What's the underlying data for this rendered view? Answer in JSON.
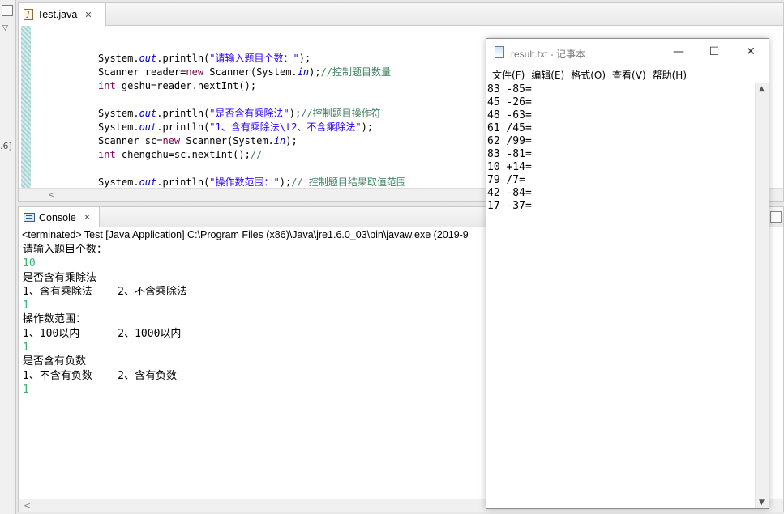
{
  "left_strip": {
    "annotation": ".6]"
  },
  "editor": {
    "tab_label": "Test.java",
    "code_lines": [
      [
        {
          "c": "pl",
          "t": "System."
        },
        {
          "c": "fld",
          "t": "out"
        },
        {
          "c": "pl",
          "t": ".println("
        },
        {
          "c": "str",
          "t": "\"请输入题目个数：\""
        },
        {
          "c": "pl",
          "t": ");"
        }
      ],
      [
        {
          "c": "pl",
          "t": "Scanner reader="
        },
        {
          "c": "kw",
          "t": "new"
        },
        {
          "c": "pl",
          "t": " Scanner(System."
        },
        {
          "c": "fld",
          "t": "in"
        },
        {
          "c": "pl",
          "t": ");"
        },
        {
          "c": "cmt",
          "t": "//控制题目数量"
        }
      ],
      [
        {
          "c": "kw",
          "t": "int"
        },
        {
          "c": "pl",
          "t": " geshu=reader.nextInt();"
        }
      ],
      [],
      [
        {
          "c": "pl",
          "t": "System."
        },
        {
          "c": "fld",
          "t": "out"
        },
        {
          "c": "pl",
          "t": ".println("
        },
        {
          "c": "str",
          "t": "\"是否含有乘除法\""
        },
        {
          "c": "pl",
          "t": ");"
        },
        {
          "c": "cmt",
          "t": "//控制题目操作符"
        }
      ],
      [
        {
          "c": "pl",
          "t": "System."
        },
        {
          "c": "fld",
          "t": "out"
        },
        {
          "c": "pl",
          "t": ".println("
        },
        {
          "c": "str",
          "t": "\"1、含有乘除法\\t2、不含乘除法\""
        },
        {
          "c": "pl",
          "t": ");"
        }
      ],
      [
        {
          "c": "pl",
          "t": "Scanner sc="
        },
        {
          "c": "kw",
          "t": "new"
        },
        {
          "c": "pl",
          "t": " Scanner(System."
        },
        {
          "c": "fld",
          "t": "in"
        },
        {
          "c": "pl",
          "t": ");"
        }
      ],
      [
        {
          "c": "kw",
          "t": "int"
        },
        {
          "c": "pl",
          "t": " chengchu=sc.nextInt();"
        },
        {
          "c": "cmt",
          "t": "//"
        }
      ],
      [],
      [
        {
          "c": "pl",
          "t": "System."
        },
        {
          "c": "fld",
          "t": "out"
        },
        {
          "c": "pl",
          "t": ".println("
        },
        {
          "c": "str",
          "t": "\"操作数范围：\""
        },
        {
          "c": "pl",
          "t": ");"
        },
        {
          "c": "cmt",
          "t": "// 控制题目结果取值范围"
        }
      ]
    ]
  },
  "console": {
    "tab_label": "Console",
    "terminated_line": "<terminated> Test [Java Application] C:\\Program Files (x86)\\Java\\jre1.6.0_03\\bin\\javaw.exe (2019-9",
    "lines": [
      {
        "t": "请输入题目个数：",
        "input": false
      },
      {
        "t": "10",
        "input": true
      },
      {
        "t": "是否含有乘除法",
        "input": false
      },
      {
        "t": "1、含有乘除法    2、不含乘除法",
        "input": false
      },
      {
        "t": "1",
        "input": true
      },
      {
        "t": "操作数范围：",
        "input": false
      },
      {
        "t": "1、100以内      2、1000以内",
        "input": false
      },
      {
        "t": "1",
        "input": true
      },
      {
        "t": "是否含有负数",
        "input": false
      },
      {
        "t": "1、不含有负数    2、含有负数",
        "input": false
      },
      {
        "t": "1",
        "input": true
      }
    ]
  },
  "notepad": {
    "title": "result.txt - 记事本",
    "controls": {
      "minimize": "—",
      "maximize": "☐",
      "close": "✕"
    },
    "menus": [
      "文件(F)",
      "编辑(E)",
      "格式(O)",
      "查看(V)",
      "帮助(H)"
    ],
    "content_lines": [
      "83 -85=",
      "45 -26=",
      "48 -63=",
      "61 /45=",
      "62 /99=",
      "83 -81=",
      "10 +14=",
      "79 /7=",
      "42 -84=",
      "17 -37="
    ]
  },
  "colors": {
    "keyword": "#7f0055",
    "field": "#0000c0",
    "string": "#2a00ff",
    "comment": "#3f7f5f",
    "console_input": "#3cb371"
  }
}
